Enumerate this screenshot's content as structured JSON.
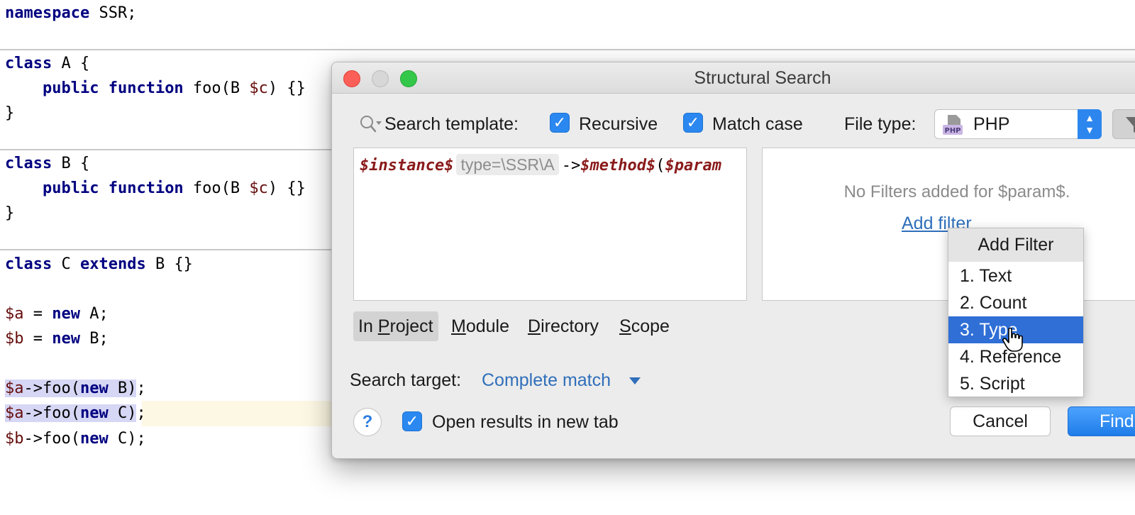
{
  "editor": {
    "lines": {
      "l1": {
        "kw": "namespace",
        "rest": " SSR;"
      },
      "l2": {
        "kw": "class",
        "rest": " A {"
      },
      "l3": {
        "indent": "    ",
        "kw1": "public",
        "kw2": "function",
        "rest1": " foo(B ",
        "var": "$c",
        "rest2": ") {}"
      },
      "l4": {
        "text": "}"
      },
      "l5": {
        "kw": "class",
        "rest": " B {"
      },
      "l6": {
        "indent": "    ",
        "kw1": "public",
        "kw2": "function",
        "rest1": " foo(B ",
        "var": "$c",
        "rest2": ") {}"
      },
      "l7": {
        "text": "}"
      },
      "l8": {
        "kw1": "class",
        "mid": " C ",
        "kw2": "extends",
        "rest": " B {}"
      },
      "l9": {
        "var": "$a",
        "mid": " = ",
        "kw": "new",
        "rest": " A;"
      },
      "l10": {
        "var": "$b",
        "mid": " = ",
        "kw": "new",
        "rest": " B;"
      },
      "l11": {
        "var": "$a",
        "mid": "->foo(",
        "kw": "new",
        "rest": " B)",
        "tail": ";"
      },
      "l12": {
        "var": "$a",
        "mid": "->foo(",
        "kw": "new",
        "rest": " C)",
        "tail": ";"
      },
      "l13": {
        "var": "$b",
        "mid": "->foo(",
        "kw": "new",
        "rest": " C);"
      }
    }
  },
  "dialog": {
    "title": "Structural Search",
    "search_template_label": "Search template:",
    "recursive_label": "Recursive",
    "recursive_checked": true,
    "match_case_label": "Match case",
    "match_case_checked": true,
    "file_type_label": "File type:",
    "file_type_value": "PHP",
    "file_type_icon_text": "PHP",
    "template": {
      "var1": "$instance$",
      "type_chip": "type=\\SSR\\A",
      "arrow": "->",
      "var2": "$method$",
      "paren": "(",
      "var3": "$param"
    },
    "no_filters_text": "No Filters added for $param$.",
    "add_filter_link": "Add filter",
    "scope_tabs": {
      "project": {
        "pre": "In ",
        "mnemonic": "P",
        "post": "roject"
      },
      "module": {
        "mnemonic": "M",
        "post": "odule"
      },
      "directory": {
        "mnemonic": "D",
        "post": "irectory"
      },
      "scope": {
        "mnemonic": "S",
        "post": "cope"
      }
    },
    "search_target_label": "Search target:",
    "search_target_value": "Complete match",
    "open_results_label": "Open results in new tab",
    "open_results_checked": true,
    "help_label": "?",
    "cancel_label": "Cancel",
    "find_label": "Find"
  },
  "popup": {
    "title": "Add Filter",
    "items": [
      "1. Text",
      "2. Count",
      "3. Type",
      "4. Reference",
      "5. Script"
    ],
    "selected_index": 2
  },
  "colors": {
    "accent": "#2f6fd6",
    "checkbox": "#2a88f0",
    "link": "#2f6fba",
    "keyword": "#000080",
    "variable": "#660e0e"
  },
  "icons": {
    "search": "search-icon",
    "filter": "filter-icon",
    "cursor": "hand-cursor-icon"
  }
}
